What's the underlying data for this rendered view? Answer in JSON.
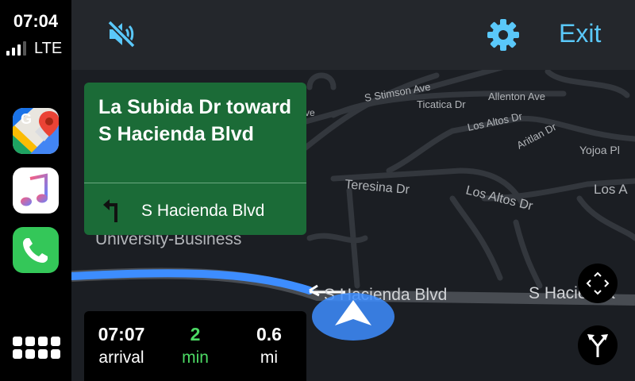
{
  "status": {
    "time": "07:04",
    "network": "LTE",
    "signal_bars": 3
  },
  "dock": {
    "apps": [
      {
        "name": "Google Maps",
        "icon": "google-maps-icon"
      },
      {
        "name": "Music",
        "icon": "music-icon"
      },
      {
        "name": "Phone",
        "icon": "phone-icon"
      }
    ],
    "home_icon": "app-grid-icon"
  },
  "topbar": {
    "mute_icon": "speaker-muted-icon",
    "settings_icon": "gear-icon",
    "exit_label": "Exit",
    "accent": "#5ac8fa"
  },
  "maneuver": {
    "title": "La Subida Dr toward S Hacienda Blvd",
    "next_turn_icon": "turn-left-icon",
    "next_street": "S Hacienda Blvd",
    "color": "#1b6b37"
  },
  "trip": {
    "arrival_time": "07:07",
    "arrival_label": "arrival",
    "remaining_time": "2",
    "remaining_time_unit": "min",
    "distance": "0.6",
    "distance_unit": "mi"
  },
  "map": {
    "streets": {
      "s_stimson_ave": "S Stimson Ave",
      "allenton_ave": "Allenton Ave",
      "ticatica_dr": "Ticatica Dr",
      "los_altos_dr_upper": "Los Altos Dr",
      "aritlan_dr": "Aritlan Dr",
      "yojoa_pl": "Yojoa Pl",
      "teresina_dr": "Teresina Dr",
      "los_altos_dr_lower": "Los Altos Dr",
      "los_altos_dr_right": "Los A",
      "university_business": "University-Business",
      "s_hacienda_blvd_left": "S Hacienda Blvd",
      "s_hacienda_blvd_right": "S Hacienda",
      "ave_fragment": "ve"
    },
    "route_color": "#3d8dff",
    "recenter_icon": "recenter-icon",
    "route_options_icon": "route-fork-icon"
  }
}
